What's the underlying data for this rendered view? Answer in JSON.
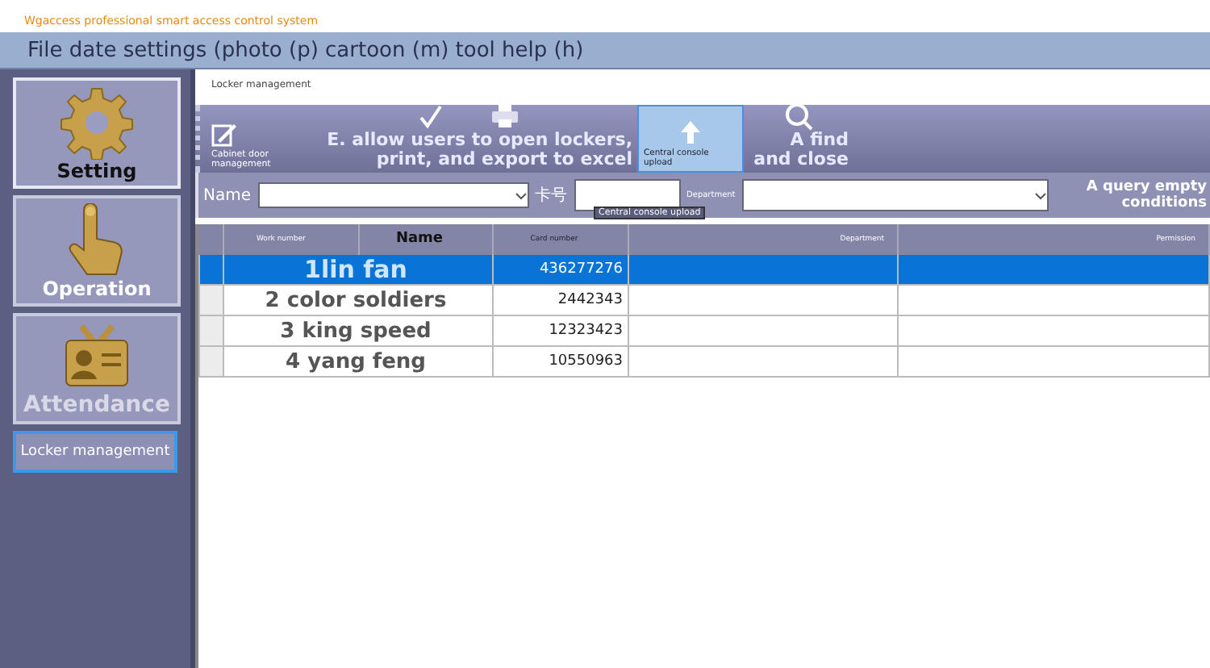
{
  "window": {
    "title": "Wgaccess professional smart access control system"
  },
  "menu_bar": {
    "text": "File date settings (photo (p) cartoon (m) tool help (h)"
  },
  "sidebar": {
    "items": [
      {
        "label": "Setting",
        "kind": "gear",
        "selected": true,
        "disabled": false
      },
      {
        "label": "Operation",
        "kind": "hand",
        "selected": false,
        "disabled": false
      },
      {
        "label": "Attendance",
        "kind": "card",
        "selected": false,
        "disabled": true
      }
    ],
    "sub_items": [
      {
        "label": "Locker management",
        "selected": true
      }
    ]
  },
  "panel": {
    "title": "Locker management"
  },
  "toolbar": [
    {
      "label": "Cabinet door management",
      "kind": "small",
      "selected": false
    },
    {
      "label": "E. allow users to open lockers, print, and export to excel",
      "kind": "large",
      "selected": false
    },
    {
      "label": "Central console upload",
      "kind": "small",
      "selected": true
    },
    {
      "label": "A find and close",
      "kind": "large",
      "selected": false
    }
  ],
  "filter": {
    "name_label": "Name",
    "card_label": "卡号",
    "department_label": "Department",
    "query_button": "A query empty conditions",
    "tooltip": "Central console upload"
  },
  "table": {
    "columns": [
      "Work number",
      "Name",
      "Card number",
      "Department",
      "Permission"
    ],
    "rows": [
      {
        "name": "1lin fan",
        "card": "436277276",
        "selected": true
      },
      {
        "name": "2 color soldiers",
        "card": "2442343",
        "selected": false
      },
      {
        "name": "3 king speed",
        "card": "12323423",
        "selected": false
      },
      {
        "name": "4 yang feng",
        "card": "10550963",
        "selected": false
      }
    ]
  }
}
